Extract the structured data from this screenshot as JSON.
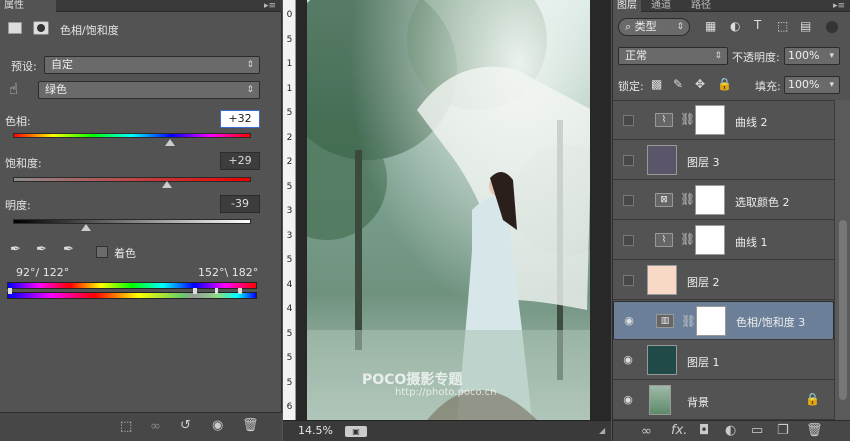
{
  "properties": {
    "tab": "属性",
    "title": "色相/饱和度",
    "preset_label": "预设:",
    "preset_value": "自定",
    "channel_value": "绿色",
    "hue_label": "色相:",
    "hue_value": "+32",
    "hue_level": 0.66,
    "sat_label": "饱和度:",
    "sat_value": "+29",
    "sat_level": 0.645,
    "light_label": "明度:",
    "light_value": "-39",
    "light_level": 0.305,
    "colorize_label": "着色",
    "range_left": "92°/ 122°",
    "range_right": "152°\\ 182°"
  },
  "ruler": [
    "0",
    "5",
    "1",
    "1",
    "5",
    "2",
    "2",
    "5",
    "3",
    "3",
    "5",
    "4",
    "4",
    "5",
    "5",
    "5",
    "6"
  ],
  "status": {
    "zoom": "14.5%"
  },
  "photo": {
    "watermark_brand": "POCO摄影专题",
    "watermark_url": "http://photo.poco.cn"
  },
  "layers_panel": {
    "tabs": [
      "图层",
      "通道",
      "路径"
    ],
    "filter": "类型",
    "blend_mode": "正常",
    "opacity_label": "不透明度:",
    "opacity_value": "100%",
    "lock_label": "锁定:",
    "fill_label": "填充:",
    "fill_value": "100%",
    "layers": [
      {
        "name": "曲线 2",
        "kind": "adjustment",
        "icon": "curves-icon",
        "visible": false
      },
      {
        "name": "图层 3",
        "kind": "fill",
        "color": "#5b5569",
        "visible": false
      },
      {
        "name": "选取颜色 2",
        "kind": "adjustment",
        "icon": "selective-color-icon",
        "visible": false
      },
      {
        "name": "曲线 1",
        "kind": "adjustment",
        "icon": "curves-icon",
        "visible": false
      },
      {
        "name": "图层 2",
        "kind": "fill",
        "color": "#f7d9c6",
        "visible": false
      },
      {
        "name": "色相/饱和度 3",
        "kind": "adjustment",
        "icon": "hue-saturation-icon",
        "visible": true,
        "selected": true
      },
      {
        "name": "图层 1",
        "kind": "fill",
        "color": "#1f4a48",
        "visible": true
      },
      {
        "name": "背景",
        "kind": "photo",
        "visible": true,
        "locked": true
      }
    ]
  }
}
